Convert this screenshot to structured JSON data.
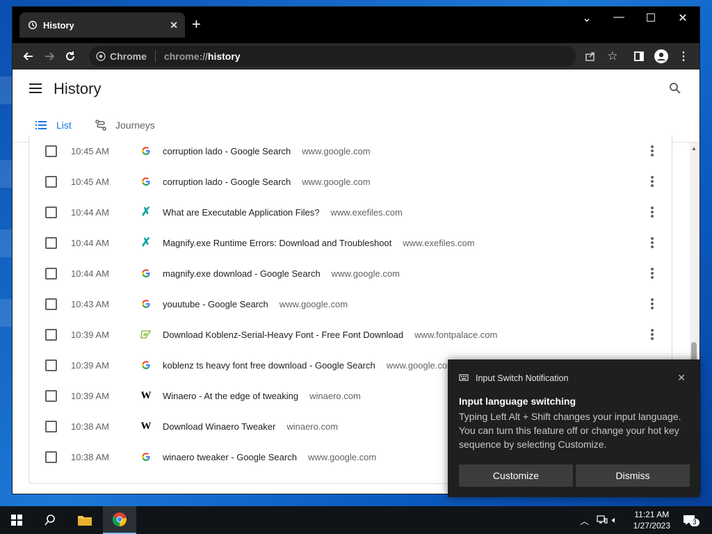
{
  "browser": {
    "tab_title": "History",
    "omnibox_chip": "Chrome",
    "url_prefix": "chrome://",
    "url_host": "history"
  },
  "page": {
    "title": "History",
    "tabs": [
      {
        "label": "List",
        "active": true
      },
      {
        "label": "Journeys",
        "active": false
      }
    ]
  },
  "history": [
    {
      "time": "10:45 AM",
      "favicon": "G",
      "title": "corruption lado - Google Search",
      "domain": "www.google.com"
    },
    {
      "time": "10:45 AM",
      "favicon": "G",
      "title": "corruption lado - Google Search",
      "domain": "www.google.com"
    },
    {
      "time": "10:44 AM",
      "favicon": "X",
      "title": "What are Executable Application Files?",
      "domain": "www.exefiles.com"
    },
    {
      "time": "10:44 AM",
      "favicon": "X",
      "title": "Magnify.exe Runtime Errors: Download and Troubleshoot",
      "domain": "www.exefiles.com"
    },
    {
      "time": "10:44 AM",
      "favicon": "G",
      "title": "magnify.exe download - Google Search",
      "domain": "www.google.com"
    },
    {
      "time": "10:43 AM",
      "favicon": "G",
      "title": "youutube - Google Search",
      "domain": "www.google.com"
    },
    {
      "time": "10:39 AM",
      "favicon": "F",
      "title": "Download Koblenz-Serial-Heavy Font - Free Font Download",
      "domain": "www.fontpalace.com"
    },
    {
      "time": "10:39 AM",
      "favicon": "G",
      "title": "koblenz ts heavy font free download - Google Search",
      "domain": "www.google.com"
    },
    {
      "time": "10:39 AM",
      "favicon": "W",
      "title": "Winaero - At the edge of tweaking",
      "domain": "winaero.com"
    },
    {
      "time": "10:38 AM",
      "favicon": "W",
      "title": "Download Winaero Tweaker",
      "domain": "winaero.com"
    },
    {
      "time": "10:38 AM",
      "favicon": "G",
      "title": "winaero tweaker - Google Search",
      "domain": "www.google.com"
    }
  ],
  "notification": {
    "app": "Input Switch Notification",
    "title": "Input language switching",
    "body": "Typing Left Alt + Shift changes your input language. You can turn this feature off or change your hot key sequence by selecting Customize.",
    "customize_label": "Customize",
    "dismiss_label": "Dismiss"
  },
  "taskbar": {
    "time": "11:21 AM",
    "date": "1/27/2023",
    "notification_count": "3"
  },
  "colors": {
    "accent": "#1a73e8",
    "google_blue": "#4285f4",
    "exefiles_teal": "#0aa5a0",
    "fontpalace_green": "#8bc34a"
  }
}
